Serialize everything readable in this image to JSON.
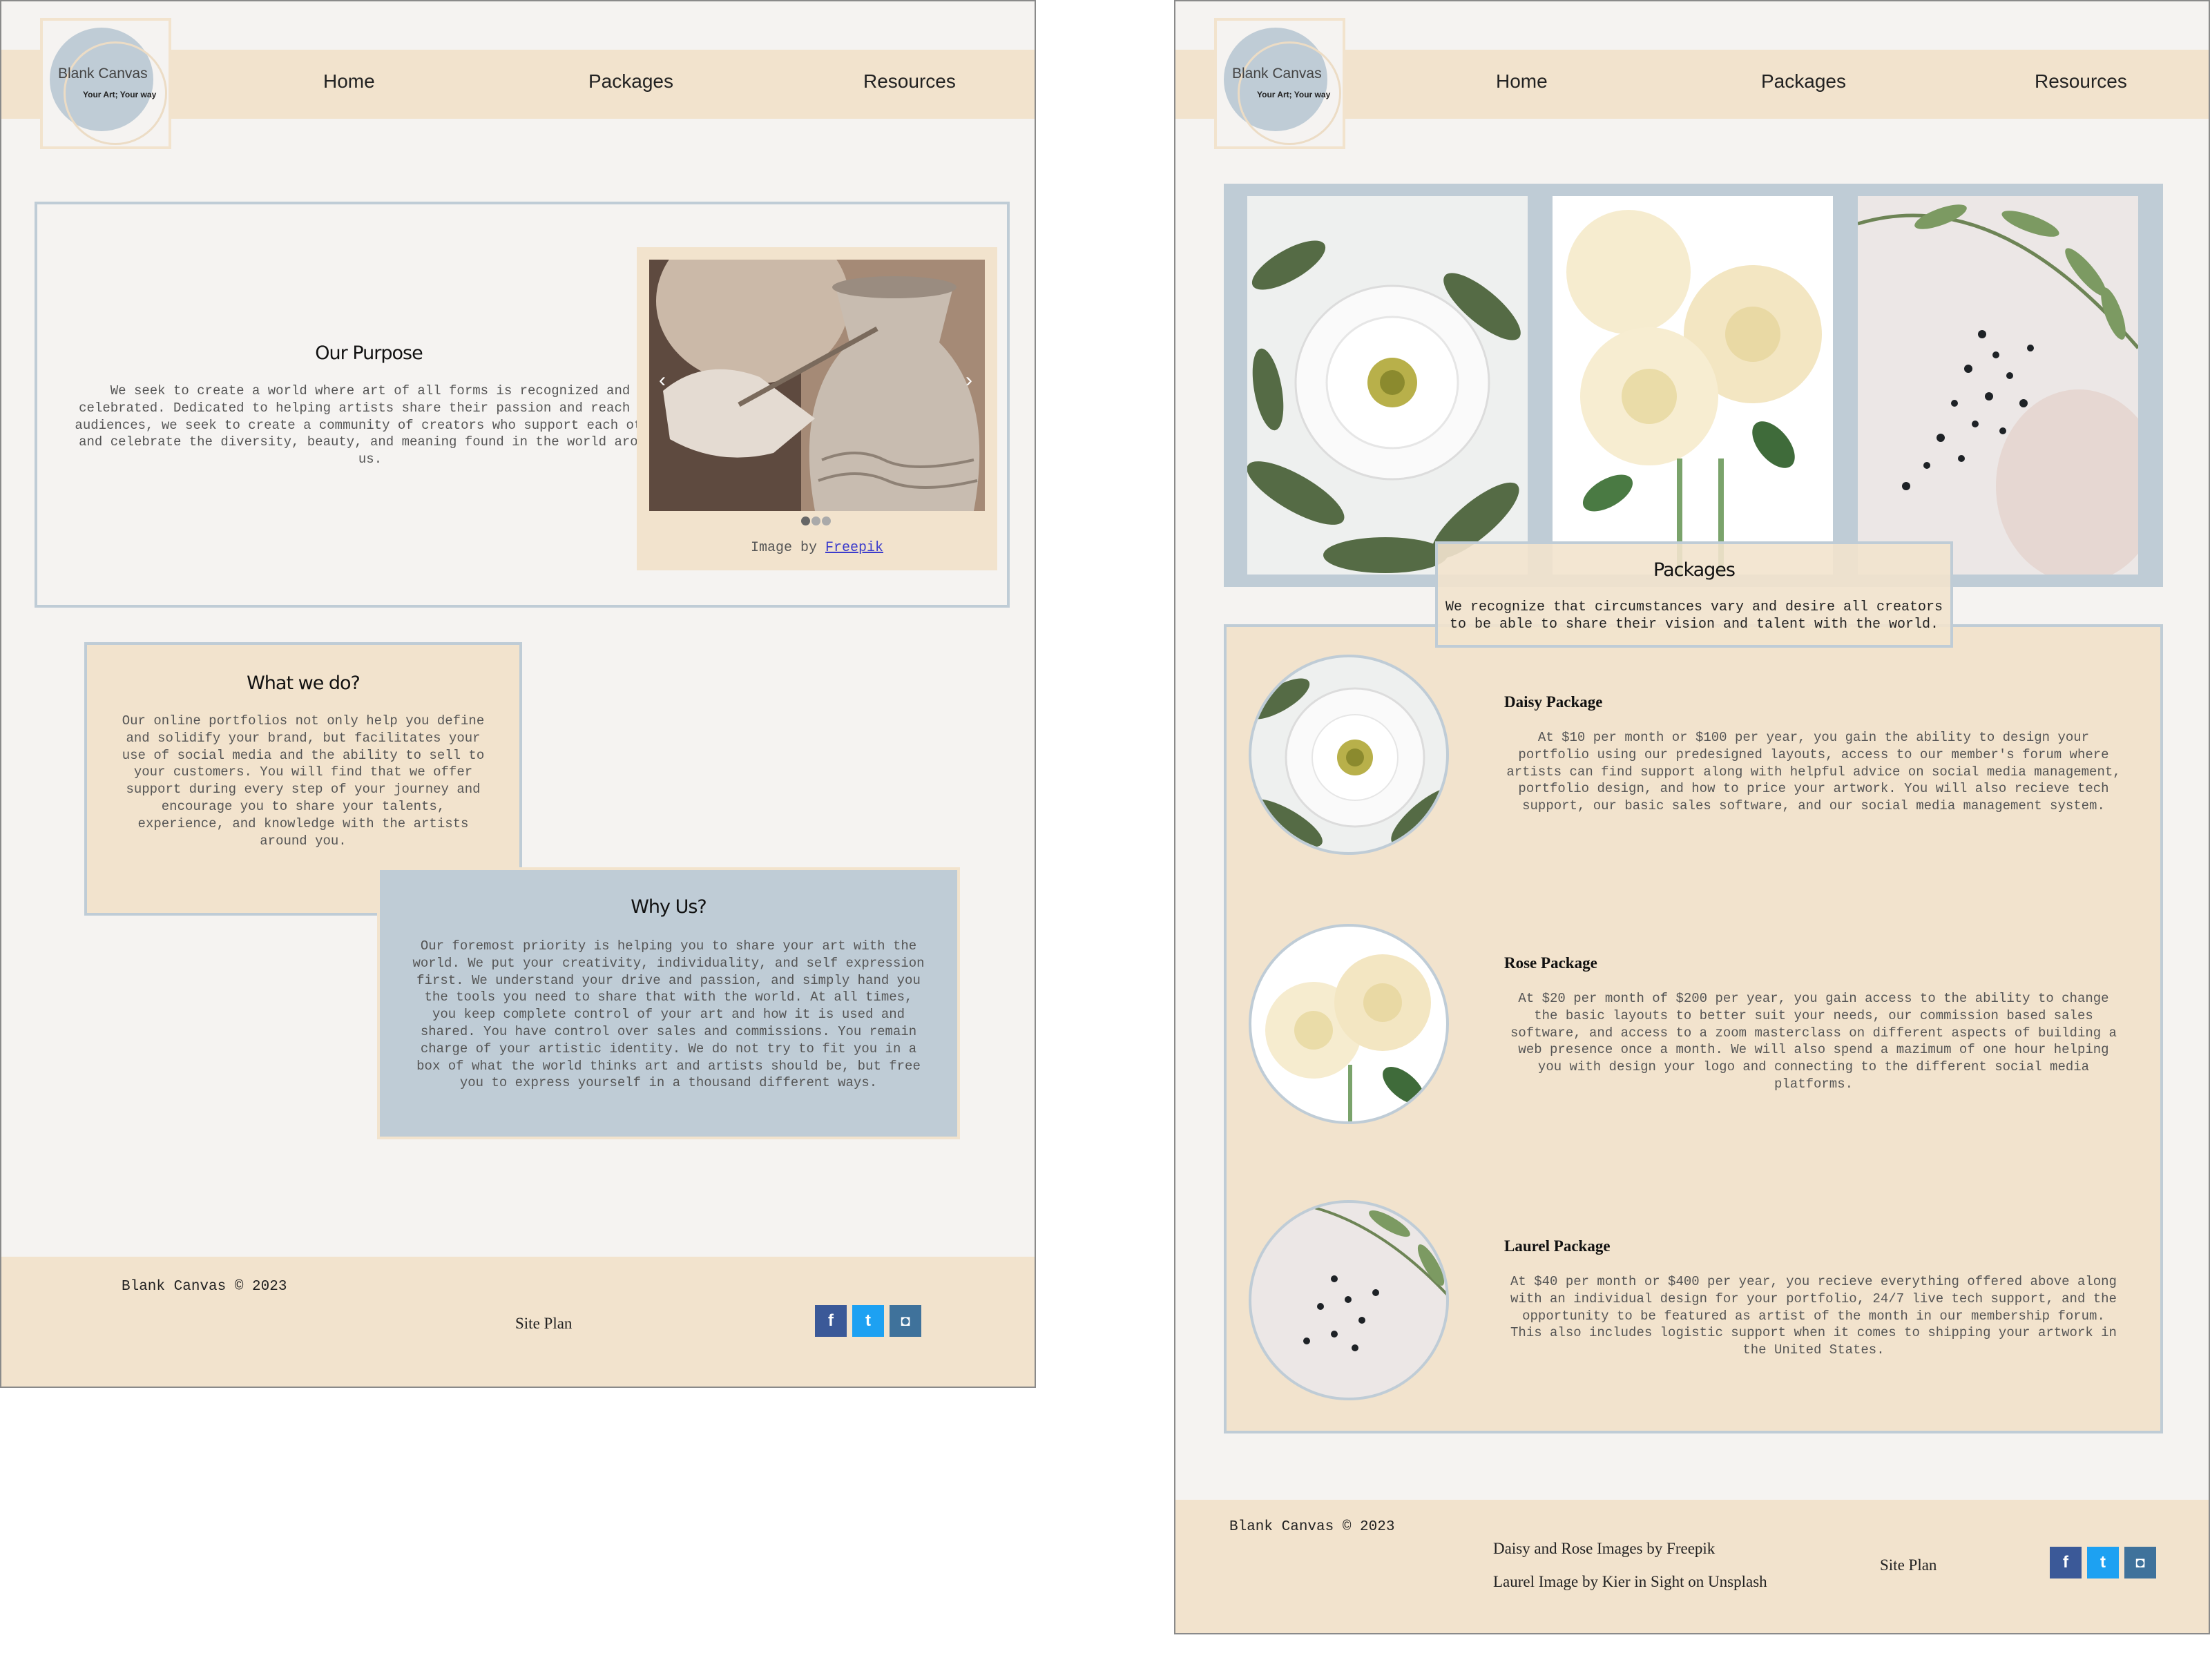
{
  "brand": {
    "name": "Blank Canvas",
    "tagline": "Your Art; Your way"
  },
  "nav": {
    "home": "Home",
    "packages": "Packages",
    "resources": "Resources"
  },
  "home": {
    "purpose_title": "Our Purpose",
    "purpose_text": "We seek to create a world where art of all forms is recognized and celebrated. Dedicated to helping artists share their passion and reach new audiences, we seek to create a community of creators who support each other and celebrate the diversity, beauty, and meaning found in the world around us.",
    "carousel": {
      "prev": "‹",
      "next": "›",
      "credit_prefix": "Image by",
      "credit_link": "Freepik",
      "active_dot": 1,
      "dot_count": 3
    },
    "what_title": "What we do?",
    "what_text": "Our online portfolios not only help you define and solidify your brand, but facilitates your use of social media and the ability to sell to your customers. You will find that we offer support during every step of your journey and encourage you to share your talents, experience, and knowledge with the artists around you.",
    "why_title": "Why Us?",
    "why_text": "Our foremost priority is helping you to share your art with the world. We put your creativity, individuality, and self expression first. We understand your drive and passion, and simply hand you the tools you need to share that with the world. At all times, you keep complete control of your art and how it is used and shared. You have control over sales and commissions. You remain charge of your artistic identity. We do not try to fit you in a box of what the world thinks art and artists should be, but free you to express yourself in a thousand different ways."
  },
  "packages_page": {
    "title": "Packages",
    "intro": "We recognize that circumstances vary and desire all creators to be able to share their vision and talent with the world.",
    "items": [
      {
        "name": "Daisy Package",
        "text": "At $10 per month or $100 per year, you gain the ability to design your portfolio using our predesigned layouts, access to our member's forum where artists can find support along with helpful advice on social media management, portfolio design, and how to price your artwork. You will also recieve tech support, our basic sales software, and our social media management system."
      },
      {
        "name": "Rose Package",
        "text": "At $20 per month of $200 per year, you gain access to the ability to change the basic layouts to better suit your needs, our commission based sales software, and access to a zoom masterclass on different aspects of building a web presence once a month. We will also spend a mazimum of one hour helping you with design your logo and connecting to the different social media platforms."
      },
      {
        "name": "Laurel Package",
        "text": "At $40 per month or $400 per year, you recieve everything offered above along with an individual design for your portfolio, 24/7 live tech support, and the opportunity to be featured as artist of the month in our membership forum. This also includes logistic support when it comes to shipping your artwork in the United States."
      }
    ]
  },
  "footer": {
    "copyright": "Blank Canvas © 2023",
    "site_plan": "Site Plan",
    "credit_1": "Daisy and Rose Images by Freepik",
    "credit_2": "Laurel Image by Kier in Sight on Unsplash",
    "social": {
      "facebook": "f",
      "twitter": "t",
      "instagram": "◘"
    }
  },
  "colors": {
    "cream": "#f2e3cd",
    "blue_grey": "#bfccd6",
    "page_bg": "#f5f3f1",
    "link": "#3b3bcc"
  }
}
